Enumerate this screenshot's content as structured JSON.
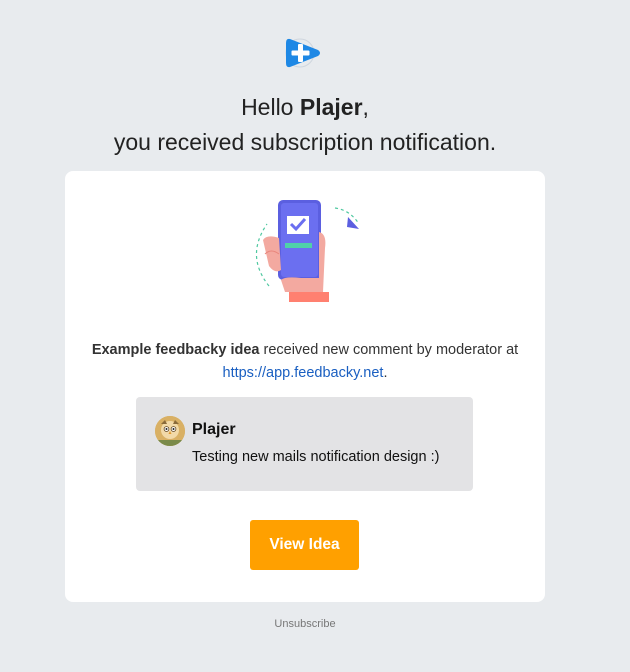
{
  "header": {
    "greeting_prefix": "Hello",
    "user_name": "Plajer",
    "greeting_suffix": ",",
    "subtitle": "you received subscription notification."
  },
  "card": {
    "idea_title": "Example feedbacky idea",
    "message_text": " received new comment by moderator at",
    "link_text": "https://app.feedbacky.net",
    "link_suffix": "."
  },
  "comment": {
    "author": "Plajer",
    "text": "Testing new mails notification design :)"
  },
  "actions": {
    "view_idea_label": "View Idea",
    "unsubscribe_label": "Unsubscribe"
  },
  "icons": {
    "logo": "feedbacky-plus-logo",
    "illustration": "hand-holding-phone-illustration",
    "avatar": "user-avatar"
  },
  "colors": {
    "background": "#e8ebee",
    "card": "#ffffff",
    "button": "#ffa000",
    "link": "#1a5fc1",
    "logo_blue": "#1e88e5",
    "comment_bg": "#e3e3e5"
  }
}
